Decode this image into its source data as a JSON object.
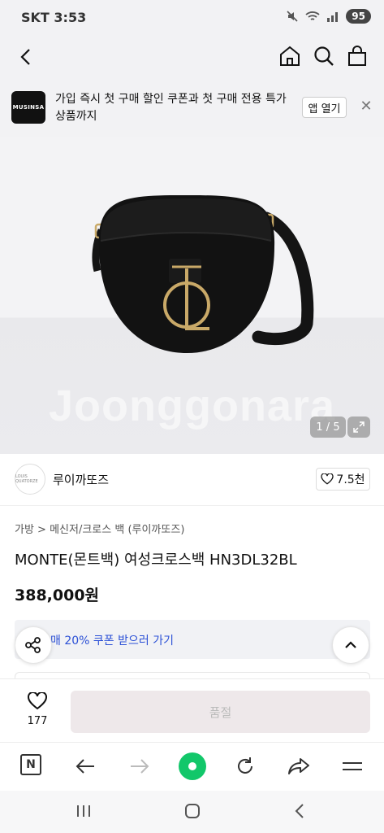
{
  "status_bar": {
    "carrier_time": "SKT 3:53",
    "battery": "95"
  },
  "top_nav": {
    "back": "back-arrow-icon",
    "home": "home-icon",
    "search": "search-icon",
    "cart": "shopping-bag-icon"
  },
  "banner": {
    "logo_text": "MUSINSA",
    "message": "가입 즉시 첫 구매 할인 쿠폰과 첫 구매 전용 특가 상품까지",
    "open_label": "앱 열기",
    "close_symbol": "✕"
  },
  "gallery": {
    "watermark": "Joonggonara",
    "counter": "1 / 5"
  },
  "shop": {
    "avatar_text": "LOUIS QUATORZE",
    "name": "루이까또즈",
    "likes": "7.5천"
  },
  "product": {
    "breadcrumb": "가방 > 메신저/크로스 백 (루이까또즈)",
    "title": "MONTE(몬트백) 여성크로스백 HN3DL32BL",
    "price": "388,000원",
    "coupon_text": "매 20% 쿠폰 받으러 가기"
  },
  "action_bar": {
    "wish_count": "177",
    "buy_label": "품절"
  },
  "colors": {
    "accent_green": "#12c76a",
    "coupon_blue": "#2b50d6"
  }
}
